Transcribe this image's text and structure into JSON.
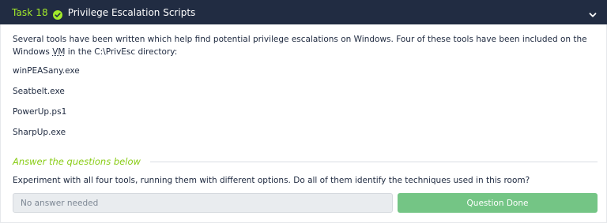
{
  "task": {
    "number_label": "Task 18",
    "title": "Privilege Escalation Scripts",
    "completed": true,
    "expanded": true,
    "icons": {
      "status": "check-circle-icon",
      "toggle": "chevron-down-icon"
    }
  },
  "content": {
    "intro_part1": "Several tools have been written which help find potential privilege escalations on Windows. Four of these tools have been included on the Windows ",
    "intro_vm": "VM",
    "intro_part2": " in the C:\\PrivEsc directory:",
    "tools": [
      "winPEASany.exe",
      "Seatbelt.exe",
      "PowerUp.ps1",
      "SharpUp.exe"
    ]
  },
  "answers": {
    "heading": "Answer the questions below",
    "questions": [
      {
        "text": "Experiment with all four tools, running them with different options. Do all of them identify the techniques used in this room?",
        "placeholder": "No answer needed",
        "button_label": "Question Done"
      }
    ]
  },
  "colors": {
    "header_bg": "#212c42",
    "accent_green": "#a3ea2a",
    "heading_green": "#88cc14",
    "done_button": "#74c585"
  }
}
